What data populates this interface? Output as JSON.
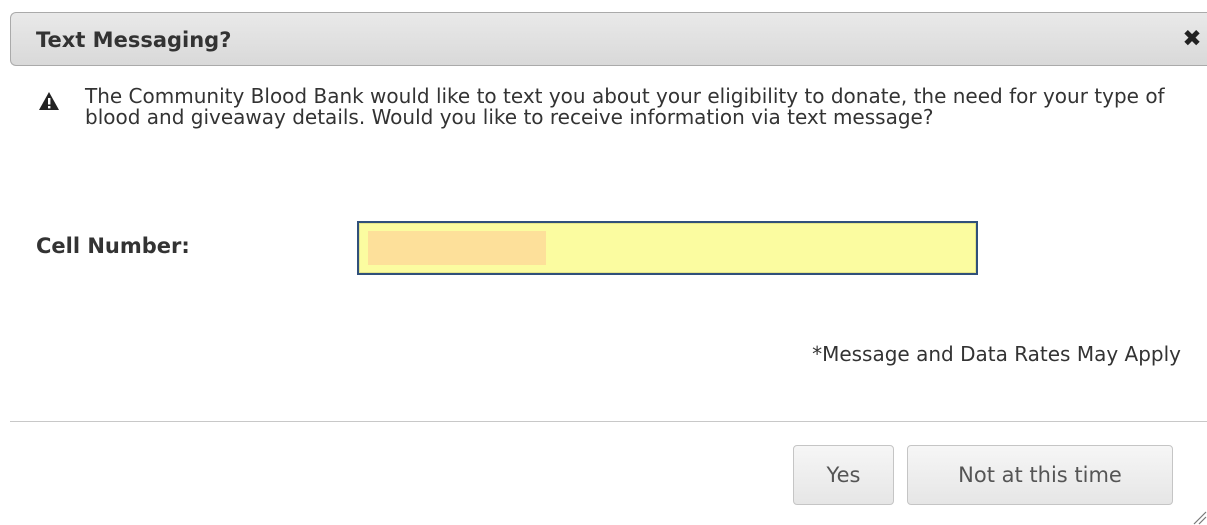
{
  "dialog": {
    "title": "Text Messaging?",
    "close_symbol": "✖",
    "message": "The Community Blood Bank would like to text you about your eligibility to donate, the need for your type of blood and giveaway details. Would you like to receive information via text message?",
    "warning_icon": "warning-triangle-icon",
    "field_label": "Cell Number:",
    "cell_value": "",
    "rates_note": "*Message and Data Rates May Apply",
    "buttons": {
      "yes": "Yes",
      "no": "Not at this time"
    }
  },
  "colors": {
    "input_background": "#fbfca0",
    "input_border": "#30507a",
    "redaction": "#fde09a"
  }
}
